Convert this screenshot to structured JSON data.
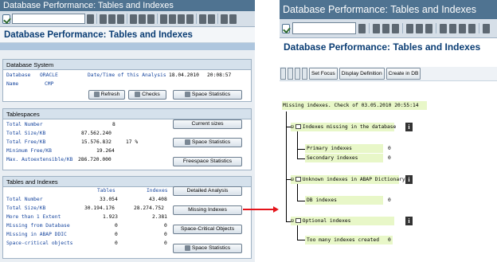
{
  "left": {
    "window_title": "Database Performance: Tables and Indexes",
    "page_title": "Database Performance: Tables and Indexes",
    "database_system": {
      "header": "Database System",
      "database_label": "Database",
      "database_value": "ORACLE",
      "name_label": "Name",
      "name_value": "CMP",
      "analysis_label": "Date/Time of this Analysis",
      "analysis_date": "18.04.2010",
      "analysis_time": "20:08:57",
      "refresh_button": "Refresh",
      "checks_button": "Checks",
      "space_stats_button": "Space Statistics"
    },
    "tablespaces": {
      "header": "Tablespaces",
      "rows": [
        {
          "label": "Total Number",
          "value": "8",
          "extra": ""
        },
        {
          "label": "Total Size/KB",
          "value": "87.562.240",
          "extra": ""
        },
        {
          "label": "Total Free/KB",
          "value": "15.576.832",
          "extra": "17 %"
        },
        {
          "label": "Minimum Free/KB",
          "value": "19.264",
          "extra": ""
        },
        {
          "label": "Max. Autoextensible/KB",
          "value": "286.720.000",
          "extra": ""
        }
      ],
      "current_sizes_button": "Current sizes",
      "space_stats_button": "Space Statistics",
      "freespace_stats_button": "Freespace Statistics"
    },
    "tables_indexes": {
      "header": "Tables and Indexes",
      "col_tables": "Tables",
      "col_indexes": "Indexes",
      "rows": [
        {
          "label": "Total Number",
          "tables": "33.054",
          "indexes": "43.408"
        },
        {
          "label": "Total Size/KB",
          "tables": "30.194.176",
          "indexes": "28.274.752"
        },
        {
          "label": "More than 1 Extent",
          "tables": "1.923",
          "indexes": "2.381"
        },
        {
          "label": "Missing from Database",
          "tables": "0",
          "indexes": "0"
        },
        {
          "label": "Missing in ABAP DDIC",
          "tables": "0",
          "indexes": "0"
        },
        {
          "label": "Space-critical objects",
          "tables": "0",
          "indexes": "0"
        }
      ],
      "detailed_analysis_button": "Detailed Analysis",
      "missing_indexes_button": "Missing Indexes",
      "space_critical_button": "Space-Critical Objects",
      "space_stats_button": "Space Statistics"
    }
  },
  "right": {
    "window_title": "Database Performance: Tables and Indexes",
    "page_title": "Database Performance: Tables and Indexes",
    "toolbar": {
      "set_focus": "Set Focus",
      "display_definition": "Display Definition",
      "create_in_db": "Create in DB"
    },
    "tree": {
      "root": "Missing indexes. Check of 03.05.2010 20:55:14",
      "groups": [
        {
          "label": "Indexes missing in the database",
          "children": [
            {
              "label": "Primary indexes",
              "count": "0"
            },
            {
              "label": "Secondary indexes",
              "count": "0"
            }
          ]
        },
        {
          "label": "Unknown indexes in ABAP Dictionary",
          "children": [
            {
              "label": "DB indexes",
              "count": "0"
            }
          ]
        },
        {
          "label": "Optional indexes",
          "children": [
            {
              "label": "Too many indexes created",
              "count": "0"
            }
          ]
        }
      ]
    }
  },
  "colors": {
    "title_bar": "#4f7391",
    "page_title_text": "#0a3d74",
    "field_text": "#16459e",
    "highlight": "#e8f7c8",
    "arrow": "#e4141b"
  }
}
